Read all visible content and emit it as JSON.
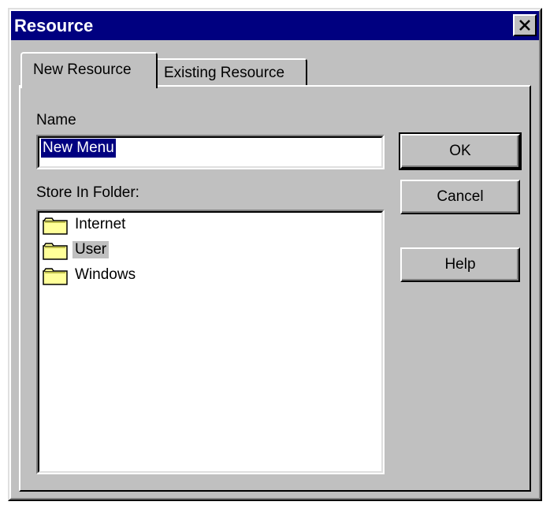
{
  "window": {
    "title": "Resource"
  },
  "tabs": [
    {
      "label": "New Resource",
      "active": true
    },
    {
      "label": "Existing Resource",
      "active": false
    }
  ],
  "form": {
    "name_label": "Name",
    "name_value": "New Menu",
    "folder_label": "Store In Folder:",
    "folders": [
      {
        "label": "Internet",
        "selected": false,
        "icon": "folder-icon"
      },
      {
        "label": "User",
        "selected": true,
        "icon": "folder-icon"
      },
      {
        "label": "Windows",
        "selected": false,
        "icon": "folder-icon"
      }
    ]
  },
  "buttons": {
    "ok": "OK",
    "cancel": "Cancel",
    "help": "Help"
  },
  "colors": {
    "titlebar": "#000080",
    "face": "#c0c0c0",
    "folder_fill": "#ffff99"
  }
}
